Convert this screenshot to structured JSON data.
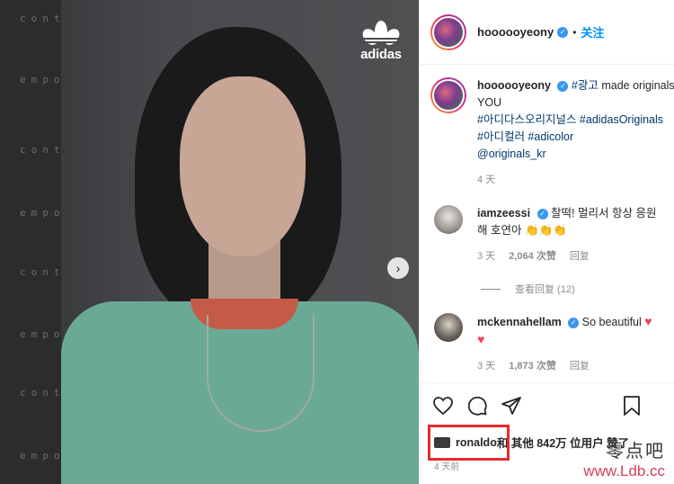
{
  "photo": {
    "side_words": [
      "cont",
      "empo",
      "cont",
      "empo",
      "cont",
      "empo",
      "cont",
      "empo"
    ],
    "brand_logo_text": "adidas",
    "next_icon": "chevron-right-icon"
  },
  "header": {
    "username": "hoooooyeony",
    "separator": "•",
    "follow_label": "关注"
  },
  "caption": {
    "username": "hoooooyeony",
    "line1_tag": "#광고",
    "line1_text": " made originals",
    "line2": "YOU",
    "line3": "#아디다스오리지널스 #adidasOriginals",
    "line4": "#아디컬러 #adicolor",
    "line5": "@originals_kr",
    "time": "4 天"
  },
  "comments": [
    {
      "username": "iamzeessi",
      "text_line1": "찰떡! 멀리서 항상 응원",
      "text_line2": "해 호연아 ",
      "emoji": "👏👏👏",
      "time": "3 天",
      "likes": "2,064 次赞",
      "reply": "回复"
    },
    {
      "username": "mckennahellam",
      "text_line1": "So beautiful",
      "heart": "♥",
      "time": "3 天",
      "likes": "1,873 次赞",
      "reply": "回复"
    }
  ],
  "view_replies": "查看回复 (12)",
  "likes_line": {
    "liked_by": "ronaldo",
    "and_others": " 和 其他 842万 位用户 赞了"
  },
  "post_time": "4 天前",
  "watermark": {
    "chinese": "零点吧",
    "url": "www.Ldb.cc"
  },
  "colors": {
    "accent_blue": "#0095f6",
    "highlight_red": "#e52b2b",
    "heart_red": "#ed4956"
  }
}
